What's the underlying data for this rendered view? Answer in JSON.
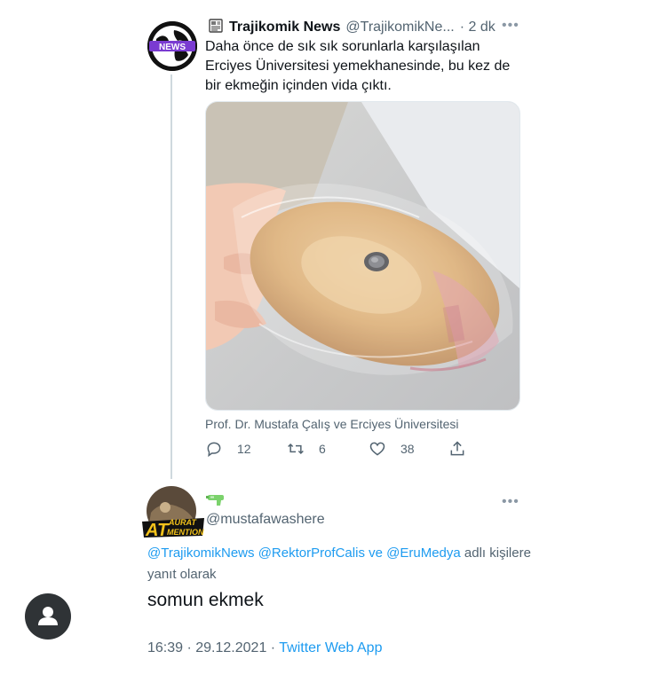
{
  "tweet": {
    "author_name": "Trajikomik News",
    "author_handle": "@TrajikomikNe...",
    "time": "· 2 dk",
    "more": "•••",
    "avatar_label": "NEWS",
    "text": "Daha önce de sık sık sorunlarla karşılaşılan Erciyes Üniversitesi yemekhanesinde, bu kez de bir ekmeğin içinden vida çıktı.",
    "tagged": "Prof. Dr. Mustafa Çalış ve Erciyes Üniversitesi",
    "replies": "12",
    "retweets": "6",
    "likes": "38"
  },
  "reply": {
    "avatar_text_top": "AURAT",
    "avatar_text_main": "AT",
    "avatar_text_sub": "MENTION",
    "handle": "@mustafawashere",
    "more": "•••",
    "reply_to_mentions_1": "@TrajikomikNews",
    "reply_to_mentions_2": "@RektorProfCalis",
    "reply_to_and": "ve",
    "reply_to_mentions_3": "@EruMedya",
    "reply_to_suffix": "adlı kişilere yanıt olarak",
    "text": "somun ekmek",
    "timestamp": "16:39 · 29.12.2021 ·",
    "source": "Twitter Web App"
  },
  "colors": {
    "accent": "#1d9bf0",
    "secondary_text": "#536471",
    "primary_text": "#0f1419"
  },
  "icons": [
    "newspaper-emoji-icon",
    "reply-icon",
    "retweet-icon",
    "like-icon",
    "share-icon",
    "water-gun-emoji-icon",
    "profile-icon"
  ]
}
